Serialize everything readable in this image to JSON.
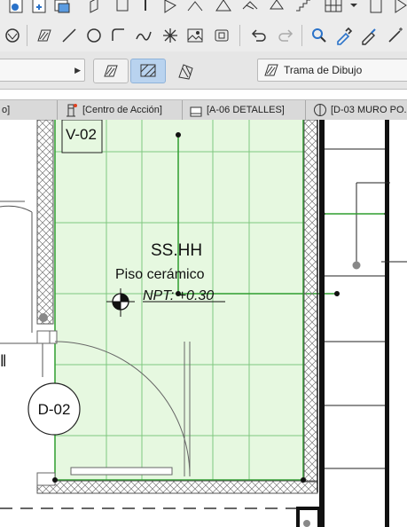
{
  "toolbar3": {
    "pen_combo_value": "",
    "fill_combo_value": "Trama de Dibujo"
  },
  "view_tabs": [
    {
      "label": "o]"
    },
    {
      "label": "[Centro de Acción]"
    },
    {
      "label": "[A-06 DETALLES]"
    },
    {
      "label": "[D-03 MURO PO..."
    }
  ],
  "drawing": {
    "window_tag": "V-02",
    "room_name": "SS.HH",
    "floor_finish": "Piso cerámico",
    "level_label": "NPT: +0.30",
    "door_tag": "D-02",
    "fill_color": "#e6f8e0",
    "grid_color": "#7fc77f",
    "line_color": "#2f9e2f"
  }
}
